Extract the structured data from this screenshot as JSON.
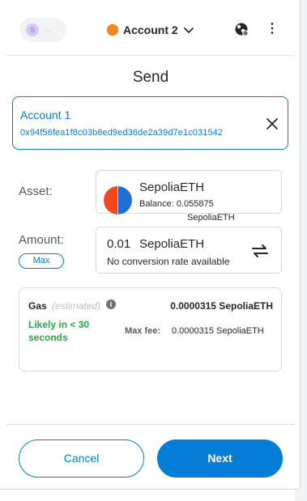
{
  "header": {
    "network_badge": "S",
    "account_name": "Account 2",
    "icons": [
      "network-chevron-icon",
      "account-chevron-icon",
      "connected-sites-icon",
      "kebab-menu-icon"
    ]
  },
  "page": {
    "title": "Send"
  },
  "recipient": {
    "name": "Account 1",
    "address": "0x94f56fea1f8c03b8ed9ed36de2a39d7e1c031542"
  },
  "asset": {
    "label": "Asset:",
    "name": "SepoliaETH",
    "balance_label": "Balance:",
    "balance_value": "0.055875",
    "balance_unit": "SepoliaETH"
  },
  "amount": {
    "label": "Amount:",
    "max_label": "Max",
    "value": "0.01",
    "unit": "SepoliaETH",
    "conversion_note": "No conversion rate available"
  },
  "gas": {
    "label": "Gas",
    "estimated_label": "(estimated)",
    "value": "0.0000315 SepoliaETH",
    "likely_text": "Likely in < 30 seconds",
    "max_fee_label": "Max fee:",
    "max_fee_value": "0.0000315 SepoliaETH"
  },
  "footer": {
    "cancel_label": "Cancel",
    "next_label": "Next"
  },
  "colors": {
    "primary": "#037dd6",
    "success": "#28a745",
    "account_dot": "#f6851b"
  }
}
